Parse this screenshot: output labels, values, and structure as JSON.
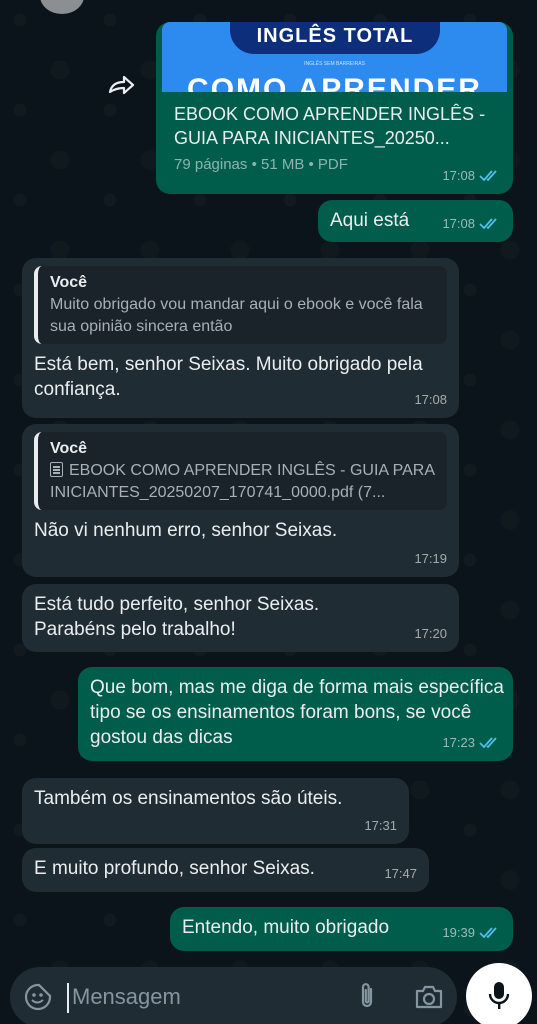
{
  "document": {
    "thumb_banner": "INGLÊS TOTAL",
    "thumb_subtitle": "INGLÊS SEM BARREIRAS",
    "thumb_title": "COMO APRENDER",
    "name": "EBOOK COMO APRENDER INGLÊS - GUIA PARA INICIANTES_20250...",
    "info": "79 páginas • 51 MB • PDF",
    "time": "17:08"
  },
  "messages": [
    {
      "text": "Aqui está",
      "time": "17:08"
    },
    {
      "quote_author": "Você",
      "quote_text": "Muito obrigado vou mandar aqui o ebook e você fala sua opinião sincera então",
      "text": "Está bem, senhor Seixas. Muito obrigado pela confiança.",
      "time": "17:08"
    },
    {
      "quote_author": "Você",
      "quote_text": "EBOOK COMO APRENDER INGLÊS - GUIA PARA INICIANTES_20250207_170741_0000.pdf (7...",
      "text": "Não vi nenhum erro, senhor Seixas.",
      "time": "17:19"
    },
    {
      "text": "Está tudo perfeito, senhor Seixas. Parabéns pelo trabalho!",
      "time": "17:20"
    },
    {
      "text": "Que bom, mas me diga de forma mais específica tipo se os ensinamentos foram bons, se você gostou das dicas",
      "time": "17:23"
    },
    {
      "text": "Também os ensinamentos são úteis.",
      "time": "17:31"
    },
    {
      "text": "E muito profundo, senhor Seixas.",
      "time": "17:47"
    },
    {
      "text": "Entendo, muito obrigado",
      "time": "19:39"
    }
  ],
  "input": {
    "placeholder": "Mensagem"
  },
  "icons": {
    "forward": "forward-icon",
    "read": "double-check-icon",
    "emoji": "sticker-icon",
    "attach": "paperclip-icon",
    "camera": "camera-icon",
    "mic": "microphone-icon"
  },
  "colors": {
    "incoming": "#202c33",
    "outgoing": "#005c4b",
    "read_tick": "#53bdeb",
    "background": "#0b141a"
  }
}
